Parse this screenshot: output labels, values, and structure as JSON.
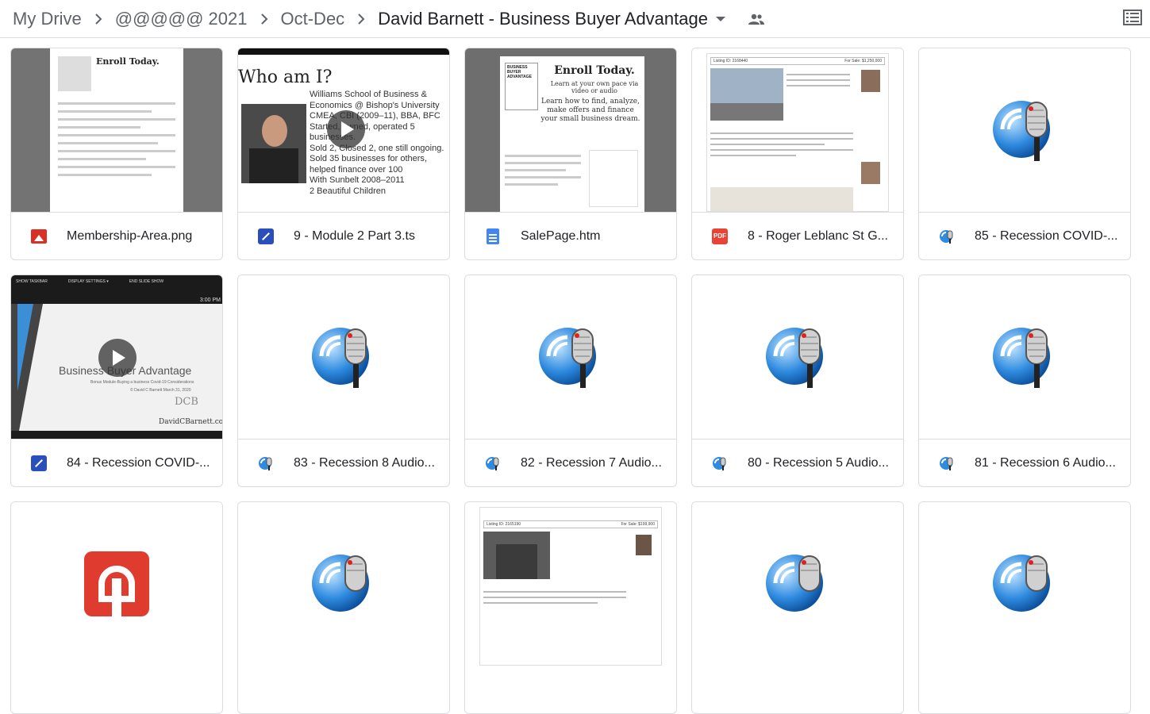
{
  "breadcrumb": {
    "items": [
      "My Drive",
      "@@@@@ 2021",
      "Oct-Dec",
      "David Barnett - Business Buyer Advantage"
    ]
  },
  "files": [
    {
      "name": "Membership-Area.png",
      "icon": "image-icon",
      "thumb": "membership"
    },
    {
      "name": "9 - Module 2 Part 3.ts",
      "icon": "video-icon",
      "thumb": "module"
    },
    {
      "name": "SalePage.htm",
      "icon": "doc-icon",
      "thumb": "sale"
    },
    {
      "name": "8 - Roger Leblanc St G...",
      "icon": "pdf-icon",
      "thumb": "pdf"
    },
    {
      "name": "85 - Recession COVID-...",
      "icon": "audio-icon",
      "thumb": "mic"
    },
    {
      "name": "84 - Recession COVID-...",
      "icon": "video-icon",
      "thumb": "covid"
    },
    {
      "name": "83 - Recession 8 Audio...",
      "icon": "audio-icon",
      "thumb": "mic"
    },
    {
      "name": "82 - Recession 7 Audio...",
      "icon": "audio-icon",
      "thumb": "mic"
    },
    {
      "name": "80 - Recession 5 Audio...",
      "icon": "audio-icon",
      "thumb": "mic"
    },
    {
      "name": "81 - Recession 6 Audio...",
      "icon": "audio-icon",
      "thumb": "mic"
    },
    {
      "name": "",
      "icon": "",
      "thumb": "app"
    },
    {
      "name": "",
      "icon": "",
      "thumb": "mic"
    },
    {
      "name": "",
      "icon": "",
      "thumb": "pdf2"
    },
    {
      "name": "",
      "icon": "",
      "thumb": "mic"
    },
    {
      "name": "",
      "icon": "",
      "thumb": "mic"
    }
  ],
  "thumbnails": {
    "membership": {
      "heading": "Enroll Today."
    },
    "module": {
      "title": "Who am I?",
      "bullets": [
        "Williams School of Business & Economics @ Bishop's University",
        "CMEA, CBI (2009–11), BBA, BFC",
        "Started, owned, operated 5 businesses.",
        "Sold 2, Closed 2, one still ongoing.",
        "Sold 35 businesses for others, helped finance over 100",
        "With Sunbelt 2008–2011",
        "2 Beautiful Children"
      ]
    },
    "sale": {
      "badge": "BUSINESS BUYER ADVANTAGE",
      "heading": "Enroll Today.",
      "sub": "Learn at your own pace via video or audio",
      "body": "Learn how to find, analyze, make offers and finance your small business dream."
    },
    "pdf": {
      "listing": "Listing ID: 2168440",
      "price": "For Sale: $1,250,000"
    },
    "covid": {
      "toolbar": [
        "SHOW TASKBAR",
        "DISPLAY SETTINGS ▾",
        "END SLIDE SHOW"
      ],
      "time": "3:00 PM",
      "title": "Business Buyer Advantage",
      "sub1": "Bonus Module-Buying a business Covid-19 Considerations",
      "sub2": "© David C Barnett March 31, 2020",
      "logo": "DCB",
      "site": "DavidCBarnett.com"
    },
    "pdf2": {
      "listing": "Listing ID: 2165190",
      "price": "For Sale: $199,900"
    }
  },
  "colors": {
    "border": "#dadce0",
    "text": "#202124",
    "muted": "#5f6368"
  }
}
